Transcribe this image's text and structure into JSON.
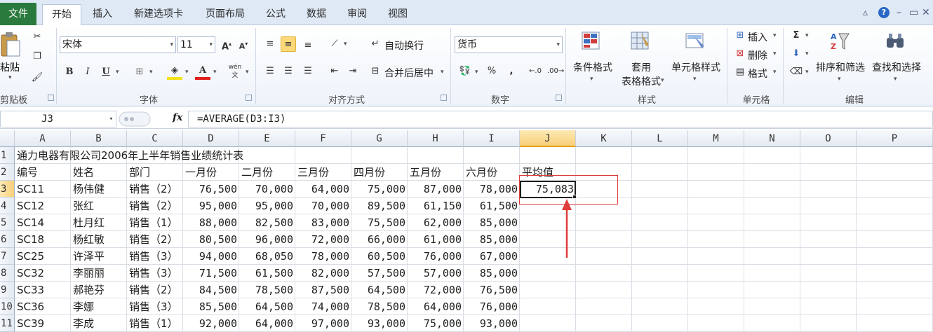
{
  "tabs": {
    "file": "文件",
    "items": [
      "开始",
      "插入",
      "新建选项卡",
      "页面布局",
      "公式",
      "数据",
      "审阅",
      "视图"
    ],
    "active": "开始"
  },
  "ribbon": {
    "clipboard": {
      "label": "剪贴板",
      "paste": "粘贴"
    },
    "font": {
      "label": "字体",
      "name": "宋体",
      "size": "11",
      "bold": "B",
      "italic": "I",
      "underline": "U",
      "grow": "A",
      "shrink": "A",
      "font_color_letter": "A",
      "pinyin": "wén"
    },
    "alignment": {
      "label": "对齐方式",
      "wrap": "自动换行",
      "merge": "合并后居中"
    },
    "number": {
      "label": "数字",
      "format": "货币",
      "percent": "%",
      "comma": ",",
      "inc_decimal": ".0",
      "dec_decimal": ".00"
    },
    "styles": {
      "label": "样式",
      "conditional": "条件格式",
      "table_line1": "套用",
      "table_line2": "表格格式",
      "cell_styles": "单元格样式"
    },
    "cells": {
      "label": "单元格",
      "insert": "插入",
      "delete": "删除",
      "format": "格式"
    },
    "editing": {
      "label": "编辑",
      "sum": "Σ",
      "sort_filter": "排序和筛选",
      "find_select": "查找和选择"
    }
  },
  "formula_bar": {
    "name_box": "J3",
    "fx": "fx",
    "formula": "=AVERAGE(D3:I3)"
  },
  "sheet": {
    "columns": [
      "A",
      "B",
      "C",
      "D",
      "E",
      "F",
      "G",
      "H",
      "I",
      "J",
      "K",
      "L",
      "M",
      "N",
      "O",
      "P"
    ],
    "selected_column": "J",
    "selected_row": "3",
    "title": "通力电器有限公司2006年上半年销售业绩统计表",
    "headers": [
      "编号",
      "姓名",
      "部门",
      "一月份",
      "二月份",
      "三月份",
      "四月份",
      "五月份",
      "六月份",
      "平均值"
    ],
    "rows": [
      {
        "row": "3",
        "cells": [
          "SC11",
          "杨伟健",
          "销售（2）",
          "76,500",
          "70,000",
          "64,000",
          "75,000",
          "87,000",
          "78,000",
          "75,083"
        ]
      },
      {
        "row": "4",
        "cells": [
          "SC12",
          "张红",
          "销售（2）",
          "95,000",
          "95,000",
          "70,000",
          "89,500",
          "61,150",
          "61,500",
          ""
        ]
      },
      {
        "row": "5",
        "cells": [
          "SC14",
          "杜月红",
          "销售（1）",
          "88,000",
          "82,500",
          "83,000",
          "75,500",
          "62,000",
          "85,000",
          ""
        ]
      },
      {
        "row": "6",
        "cells": [
          "SC18",
          "杨红敏",
          "销售（2）",
          "80,500",
          "96,000",
          "72,000",
          "66,000",
          "61,000",
          "85,000",
          ""
        ]
      },
      {
        "row": "7",
        "cells": [
          "SC25",
          "许泽平",
          "销售（3）",
          "94,000",
          "68,050",
          "78,000",
          "60,500",
          "76,000",
          "67,000",
          ""
        ]
      },
      {
        "row": "8",
        "cells": [
          "SC32",
          "李丽丽",
          "销售（3）",
          "71,500",
          "61,500",
          "82,000",
          "57,500",
          "57,000",
          "85,000",
          ""
        ]
      },
      {
        "row": "9",
        "cells": [
          "SC33",
          "郝艳芬",
          "销售（2）",
          "84,500",
          "78,500",
          "87,500",
          "64,500",
          "72,000",
          "76,500",
          ""
        ]
      },
      {
        "row": "10",
        "cells": [
          "SC36",
          "李娜",
          "销售（3）",
          "85,500",
          "64,500",
          "74,000",
          "78,500",
          "64,000",
          "76,000",
          ""
        ]
      },
      {
        "row": "11",
        "cells": [
          "SC39",
          "李成",
          "销售（1）",
          "92,000",
          "64,000",
          "97,000",
          "93,000",
          "75,000",
          "93,000",
          ""
        ]
      }
    ]
  },
  "annotation_color": "#e03c3c"
}
